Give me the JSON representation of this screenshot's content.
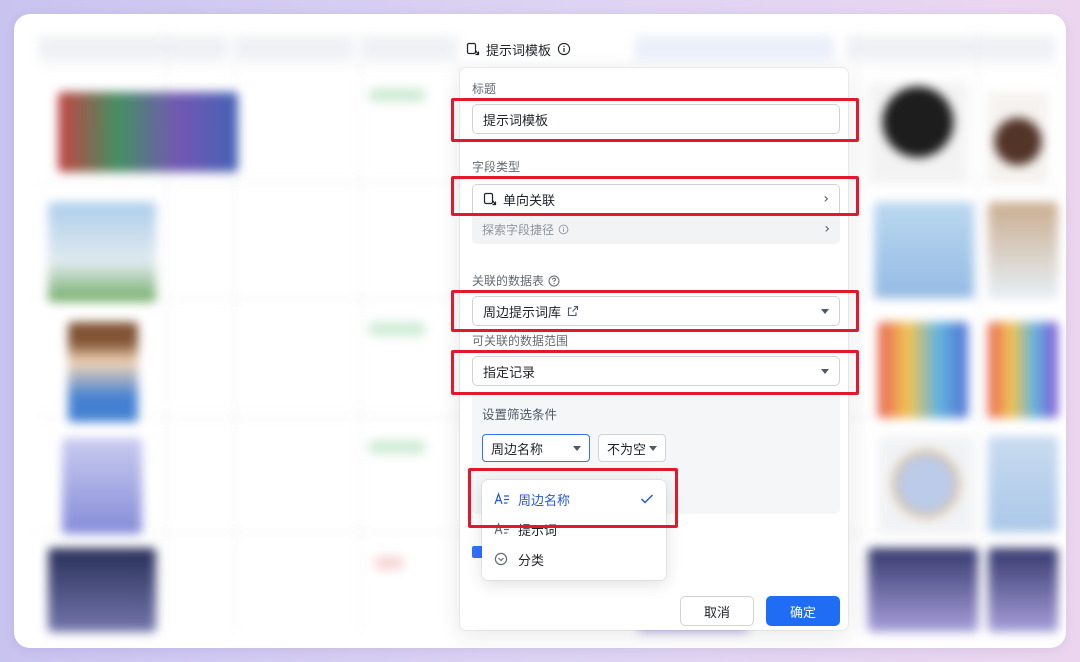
{
  "column_header": {
    "title": "提示词模板"
  },
  "panel": {
    "title_label": "标题",
    "title_value": "提示词模板",
    "field_type_label": "字段类型",
    "field_type_value": "单向关联",
    "explore_path_label": "探索字段捷径",
    "linked_table_label": "关联的数据表",
    "linked_table_value": "周边提示词库",
    "range_label": "可关联的数据范围",
    "range_value": "指定记录",
    "filter": {
      "title": "设置筛选条件",
      "field_value": "周边名称",
      "operator_value": "不为空"
    },
    "dropdown_options": [
      {
        "label": "周边名称",
        "icon": "text-field-icon",
        "selected": true
      },
      {
        "label": "提示词",
        "icon": "text-field-icon",
        "selected": false
      },
      {
        "label": "分类",
        "icon": "single-select-icon",
        "selected": false
      }
    ],
    "cancel_label": "取消",
    "confirm_label": "确定"
  },
  "colors": {
    "accent": "#1f6cf5",
    "highlight": "#e3182d",
    "check": "#3370ff"
  }
}
